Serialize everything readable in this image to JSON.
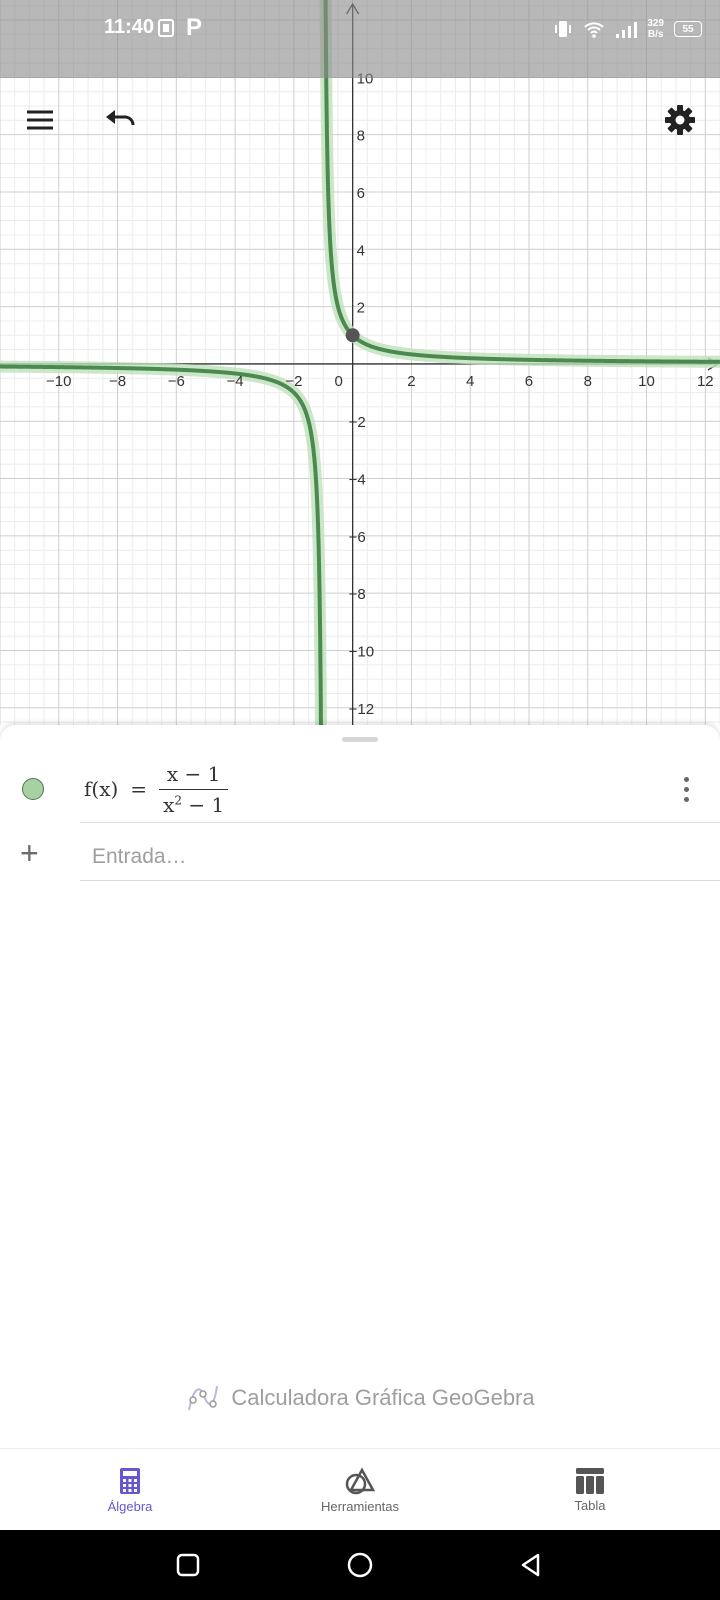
{
  "status_bar": {
    "time": "11:40",
    "net_speed_value": "329",
    "net_speed_unit": "B/s",
    "battery": "55"
  },
  "toolbar": {
    "menu_icon": "hamburger-menu-icon",
    "undo_icon": "undo-icon",
    "settings_icon": "gear-icon"
  },
  "graph": {
    "x_ticks": [
      "−10",
      "−8",
      "−6",
      "−4",
      "−2",
      "0",
      "2",
      "4",
      "6",
      "8",
      "10",
      "12"
    ],
    "y_ticks_pos": [
      "10",
      "8",
      "6",
      "4",
      "2"
    ],
    "y_ticks_neg": [
      "−2",
      "−4",
      "−6",
      "−8",
      "−10",
      "−12"
    ],
    "x_range": [
      -12,
      12.5
    ],
    "y_range": [
      -12.6,
      12.7
    ],
    "curve_color": "#4b8a4e",
    "curve_glow_color": "#bfe0bc",
    "point_color": "#555555",
    "point": {
      "x": 0,
      "y": 1
    }
  },
  "algebra": {
    "function_name": "f(x)",
    "equals": "=",
    "numerator": "x − 1",
    "denominator_base": "x",
    "denominator_exp": "2",
    "denominator_rest": "− 1",
    "input_placeholder": "Entrada…"
  },
  "branding": {
    "app_name": "Calculadora Gráfica GeoGebra"
  },
  "bottom_nav": {
    "algebra_label": "Álgebra",
    "tools_label": "Herramientas",
    "table_label": "Tabla",
    "accent_color": "#6557d2"
  }
}
